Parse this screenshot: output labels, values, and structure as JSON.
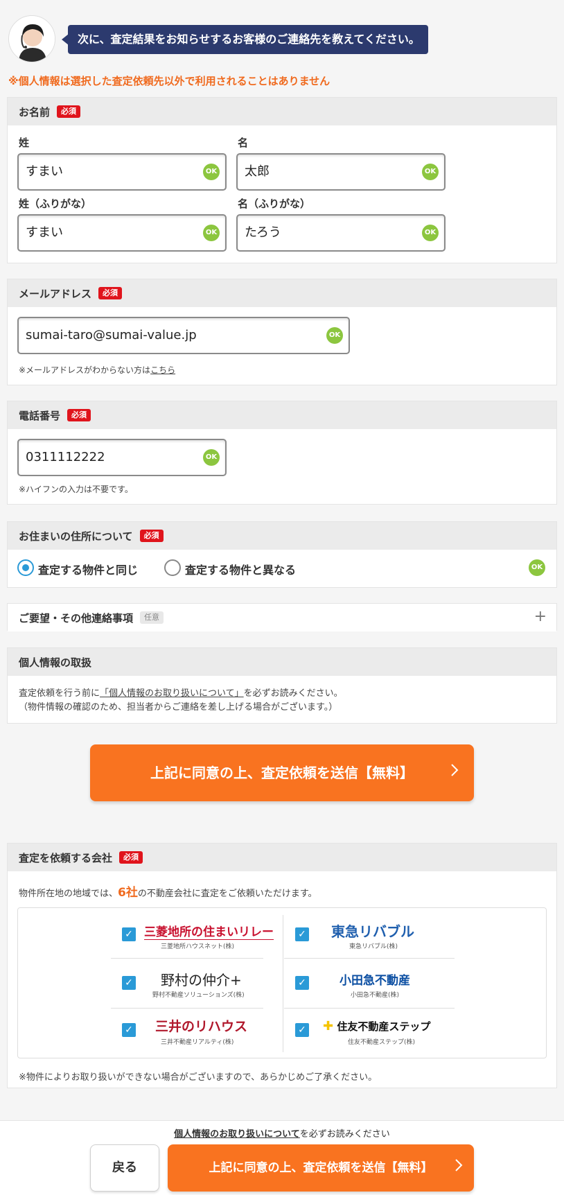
{
  "header": {
    "bubble_text": "次に、査定結果をお知らせするお客様のご連絡先を教えてください。",
    "privacy_note": "※個人情報は選択した査定依頼先以外で利用されることはありません"
  },
  "name_section": {
    "title": "お名前",
    "required_badge": "必須",
    "last_name_label": "姓",
    "first_name_label": "名",
    "last_name_value": "すまい",
    "first_name_value": "太郎",
    "last_kana_label": "姓（ふりがな）",
    "first_kana_label": "名（ふりがな）",
    "last_kana_value": "すまい",
    "first_kana_value": "たろう",
    "ok": "OK"
  },
  "email_section": {
    "title": "メールアドレス",
    "required_badge": "必須",
    "value": "sumai-taro@sumai-value.jp",
    "note_prefix": "※メールアドレスがわからない方は",
    "note_link": "こちら",
    "ok": "OK"
  },
  "phone_section": {
    "title": "電話番号",
    "required_badge": "必須",
    "value": "0311112222",
    "note": "※ハイフンの入力は不要です。",
    "ok": "OK"
  },
  "address_section": {
    "title": "お住まいの住所について",
    "required_badge": "必須",
    "option_same": "査定する物件と同じ",
    "option_diff": "査定する物件と異なる",
    "ok": "OK"
  },
  "requests_section": {
    "title": "ご要望・その他連絡事項",
    "optional_badge": "任意",
    "expand_icon": "+"
  },
  "privacy_section": {
    "title": "個人情報の取扱",
    "text_prefix": "査定依頼を行う前に",
    "text_link": "「個人情報のお取り扱いについて」",
    "text_suffix": "を必ずお読みください。",
    "text_line2": "（物件情報の確認のため、担当者からご連絡を差し上げる場合がございます。）"
  },
  "submit_button": {
    "label": "上記に同意の上、査定依頼を送信【無料】",
    "chevron": "〉"
  },
  "companies_section": {
    "title": "査定を依頼する会社",
    "required_badge": "必須",
    "intro_prefix": "物件所在地の地域では、",
    "intro_count": "6社",
    "intro_suffix": "の不動産会社に査定をご依頼いただけます。",
    "companies": [
      {
        "logo": "三菱地所の住まいリレー",
        "name": "三菱地所ハウスネット(株)",
        "color": "#c8102e"
      },
      {
        "logo": "東急リバブル",
        "name": "東急リバブル(株)",
        "color": "#1f5fae"
      },
      {
        "logo": "野村の仲介+",
        "name": "野村不動産ソリューションズ(株)",
        "color": "#222222"
      },
      {
        "logo": "小田急不動産",
        "name": "小田急不動産(株)",
        "color": "#0b4ea2"
      },
      {
        "logo": "三井のリハウス",
        "name": "三井不動産リアルティ(株)",
        "color": "#b0172b"
      },
      {
        "logo": "住友不動産ステップ",
        "name": "住友不動産ステップ(株)",
        "color": "#111111"
      }
    ],
    "note": "※物件によりお取り扱いができない場合がございますので、あらかじめご了承ください。"
  },
  "footer": {
    "notice_link": "個人情報のお取り扱いについて",
    "notice_suffix": "を必ずお読みください",
    "back_label": "戻る",
    "submit_label": "上記に同意の上、査定依頼を送信【無料】",
    "chevron": "〉"
  },
  "colors": {
    "accent_orange": "#f97320",
    "required_red": "#e0141c",
    "ok_green": "#8cc63f",
    "bubble_navy": "#2c3a6e",
    "check_blue": "#2a9ad7"
  }
}
